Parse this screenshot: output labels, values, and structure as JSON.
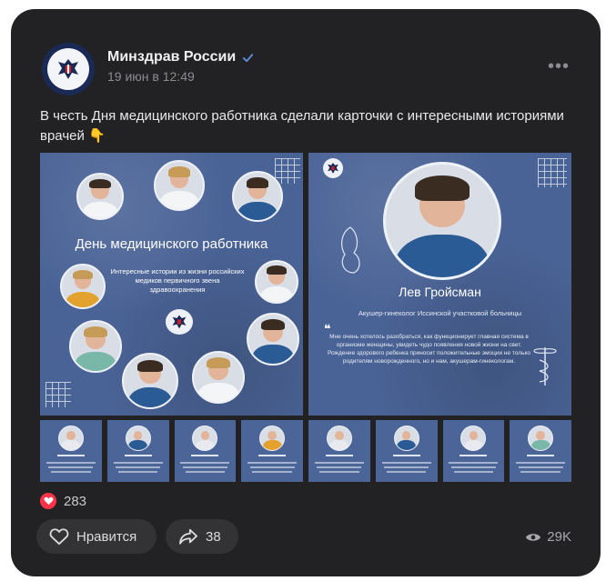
{
  "post": {
    "author": "Минздрав России",
    "date": "19 июн в 12:49",
    "text": "В честь Дня медицинского работника сделали карточки с интересными историями врачей",
    "text_emoji_icon": "pointing-down-hand-emoji"
  },
  "images": {
    "left": {
      "title": "День медицинского работника",
      "subtitle": "Интересные истории из жизни российских медиков первичного звена здравоохранения"
    },
    "right": {
      "name": "Лев Гройсман",
      "role": "Акушер-гинеколог Иссинской участковой больницы",
      "quote": "Мне очень хотелось разобраться, как функционирует главная система в организме женщины, увидеть чудо появления новой жизни на свет. Рождение здорового ребенка приносит положительные эмоции не только родителям новорожденного, но и нам, акушерам-гинекологам."
    },
    "thumb_count": 8
  },
  "reactions": {
    "likes_count": "283",
    "like_label": "Нравится",
    "share_count": "38",
    "views": "29K"
  },
  "colors": {
    "card_bg": "#222224",
    "image_blue": "#4a6396",
    "like_red": "#ff3347",
    "verified_blue": "#5f8fdb"
  }
}
